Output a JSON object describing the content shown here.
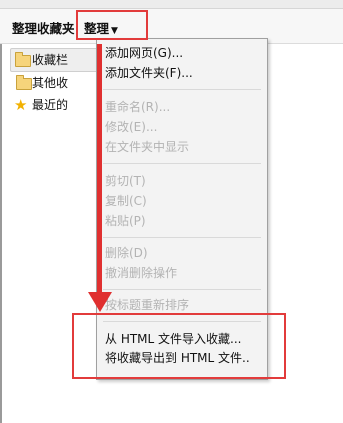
{
  "toolbar": {
    "title": "整理收藏夹",
    "organize_label": "整理"
  },
  "tree": [
    {
      "label": "收藏栏",
      "icon": "folder-icon"
    },
    {
      "label": "其他收",
      "icon": "folder-icon"
    },
    {
      "label": "最近的",
      "icon": "star-icon"
    }
  ],
  "menu": {
    "add_page": "添加网页(G)...",
    "add_folder": "添加文件夹(F)...",
    "rename": "重命名(R)...",
    "edit": "修改(E)...",
    "show_in_folder": "在文件夹中显示",
    "cut": "剪切(T)",
    "copy": "复制(C)",
    "paste": "粘贴(P)",
    "delete": "删除(D)",
    "undo_delete": "撤消删除操作",
    "sort_by_title": "按标题重新排序",
    "import_html": "从 HTML 文件导入收藏...",
    "export_html": "将收藏导出到 HTML 文件.."
  },
  "colors": {
    "highlight": "#e23b3b",
    "arrow": "#e03030",
    "menu_bg": "#f3f3f3",
    "disabled_text": "#b3b3b3"
  }
}
